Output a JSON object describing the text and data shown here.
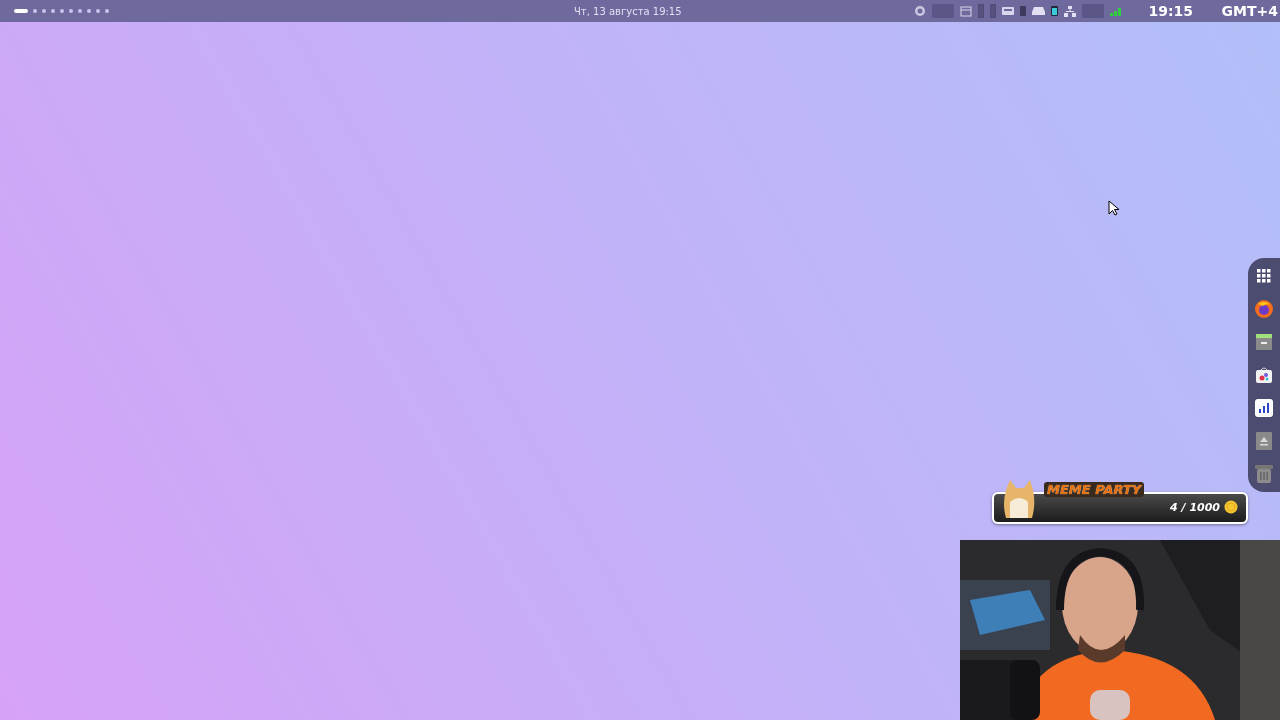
{
  "top_bar": {
    "workspaces": [
      {
        "selected": true
      },
      {
        "selected": false
      },
      {
        "selected": false
      },
      {
        "selected": false
      },
      {
        "selected": false
      },
      {
        "selected": false
      },
      {
        "selected": false
      },
      {
        "selected": false
      },
      {
        "selected": false
      },
      {
        "selected": false
      }
    ],
    "date": "Чт, 13 августа  19:15",
    "clock": "19:15",
    "timezone": "GMT+4"
  },
  "dock": {
    "items": [
      {
        "kind": "apps"
      },
      {
        "kind": "browser"
      },
      {
        "kind": "files"
      },
      {
        "kind": "store"
      },
      {
        "kind": "monitor"
      },
      {
        "kind": "eject"
      },
      {
        "kind": "trash"
      }
    ]
  },
  "overlay": {
    "title": "MEME PARTY",
    "count": "4 / 1000"
  }
}
